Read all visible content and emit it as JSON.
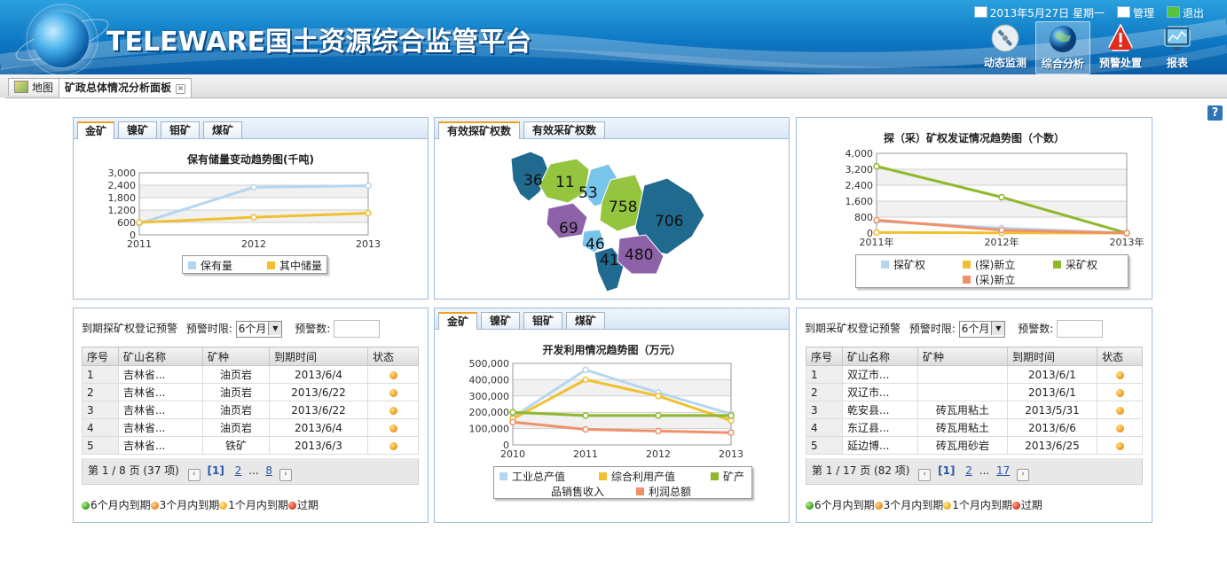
{
  "header": {
    "app_title": "TELEWARE国土资源综合监管平台",
    "date": "2013年5月27日 星期一",
    "admin_label": "管理",
    "logout_label": "退出",
    "nav": [
      {
        "label": "动态监测",
        "icon": "satellite-icon"
      },
      {
        "label": "综合分析",
        "icon": "globe-icon"
      },
      {
        "label": "预警处置",
        "icon": "warning-icon"
      },
      {
        "label": "报表",
        "icon": "monitor-icon"
      }
    ]
  },
  "tabs": {
    "map": "地图",
    "dashboard": "矿政总体情况分析面板"
  },
  "panel1": {
    "tabs": [
      "金矿",
      "镍矿",
      "钼矿",
      "煤矿"
    ],
    "chart_data": {
      "type": "line",
      "title": "保有储量变动趋势图(千吨)",
      "x": [
        "2011",
        "2012",
        "2013"
      ],
      "ylim": [
        0,
        3000
      ],
      "yticks": [
        "0",
        "600",
        "1,200",
        "1,800",
        "2,400",
        "3,000"
      ],
      "series": [
        {
          "name": "保有量",
          "color": "#b5d6f0",
          "values": [
            550,
            2300,
            2380
          ]
        },
        {
          "name": "其中储量",
          "color": "#f0c030",
          "values": [
            600,
            850,
            1050
          ]
        }
      ]
    }
  },
  "panel2": {
    "tabs": [
      "有效探矿权数",
      "有效采矿权数"
    ],
    "map_regions": [
      {
        "label": "36",
        "color": "#1f6a8e"
      },
      {
        "label": "11",
        "color": "#95c53e"
      },
      {
        "label": "53",
        "color": "#79c4ea"
      },
      {
        "label": "758",
        "color": "#95c53e"
      },
      {
        "label": "706",
        "color": "#1f6a8e"
      },
      {
        "label": "69",
        "color": "#8e62a8"
      },
      {
        "label": "46",
        "color": "#79c4ea"
      },
      {
        "label": "41",
        "color": "#1f6a8e"
      },
      {
        "label": "480",
        "color": "#8e62a8"
      }
    ]
  },
  "panel3": {
    "chart_data": {
      "type": "line",
      "title": "探（采）矿权发证情况趋势图（个数）",
      "x": [
        "2011年",
        "2012年",
        "2013年"
      ],
      "ylim": [
        0,
        4000
      ],
      "yticks": [
        "0",
        "800",
        "1,600",
        "2,400",
        "3,200",
        "4,000"
      ],
      "series": [
        {
          "name": "探矿权",
          "color": "#b5d6f0",
          "values": [
            600,
            250,
            0
          ]
        },
        {
          "name": "(探)新立",
          "color": "#f0c030",
          "values": [
            30,
            10,
            0
          ]
        },
        {
          "name": "采矿权",
          "color": "#8fb82c",
          "values": [
            3350,
            1800,
            0
          ]
        },
        {
          "name": "(采)新立",
          "color": "#f0906a",
          "values": [
            650,
            150,
            0
          ]
        }
      ]
    }
  },
  "panel4": {
    "title": "到期探矿权登记预警",
    "limit_label": "预警时限:",
    "limit_value": "6个月",
    "count_label": "预警数:",
    "columns": [
      "序号",
      "矿山名称",
      "矿种",
      "到期时间",
      "状态"
    ],
    "rows": [
      [
        "1",
        "吉林省...",
        "油页岩",
        "2013/6/4"
      ],
      [
        "2",
        "吉林省...",
        "油页岩",
        "2013/6/22"
      ],
      [
        "3",
        "吉林省...",
        "油页岩",
        "2013/6/22"
      ],
      [
        "4",
        "吉林省...",
        "油页岩",
        "2013/6/4"
      ],
      [
        "5",
        "吉林省...",
        "铁矿",
        "2013/6/3"
      ]
    ],
    "pager_text": "第 1 / 8 页 (37 项)",
    "page_current": "[1]",
    "page_next": "2",
    "page_ellipsis": "...",
    "page_last": "8",
    "status_legend": [
      "6个月内到期",
      "3个月内到期",
      "1个月内到期",
      "过期"
    ]
  },
  "panel5": {
    "tabs": [
      "金矿",
      "镍矿",
      "钼矿",
      "煤矿"
    ],
    "chart_data": {
      "type": "line",
      "title": "开发利用情况趋势图（万元）",
      "x": [
        "2010",
        "2011",
        "2012",
        "2013"
      ],
      "ylim": [
        0,
        500000
      ],
      "yticks": [
        "0",
        "100,000",
        "200,000",
        "300,000",
        "400,000",
        "500,000"
      ],
      "series": [
        {
          "name": "工业总产值",
          "color": "#b5d6f0",
          "values": [
            170000,
            460000,
            320000,
            190000
          ]
        },
        {
          "name": "综合利用产值",
          "color": "#f0c030",
          "values": [
            160000,
            400000,
            300000,
            150000
          ]
        },
        {
          "name": "矿产品销售收入",
          "color": "#8fb82c",
          "values": [
            200000,
            180000,
            180000,
            180000
          ]
        },
        {
          "name": "利润总额",
          "color": "#f0906a",
          "values": [
            140000,
            95000,
            85000,
            75000
          ]
        }
      ],
      "legend_row1": [
        "工业总产值",
        "综合利用产值",
        "矿产"
      ],
      "legend_row2_text": "品销售收入",
      "legend_row2_item": "利润总额"
    }
  },
  "panel6": {
    "title": "到期采矿权登记预警",
    "limit_label": "预警时限:",
    "limit_value": "6个月",
    "count_label": "预警数:",
    "columns": [
      "序号",
      "矿山名称",
      "矿种",
      "到期时间",
      "状态"
    ],
    "rows": [
      [
        "1",
        "双辽市...",
        "",
        "2013/6/1"
      ],
      [
        "2",
        "双辽市...",
        "",
        "2013/6/1"
      ],
      [
        "3",
        "乾安县...",
        "砖瓦用粘土",
        "2013/5/31"
      ],
      [
        "4",
        "东辽县...",
        "砖瓦用粘土",
        "2013/6/6"
      ],
      [
        "5",
        "延边博...",
        "砖瓦用砂岩",
        "2013/6/25"
      ]
    ],
    "pager_text": "第 1 / 17 页 (82 项)",
    "page_current": "[1]",
    "page_next": "2",
    "page_ellipsis": "...",
    "page_last": "17",
    "status_legend": [
      "6个月内到期",
      "3个月内到期",
      "1个月内到期",
      "过期"
    ]
  },
  "help_label": "?"
}
